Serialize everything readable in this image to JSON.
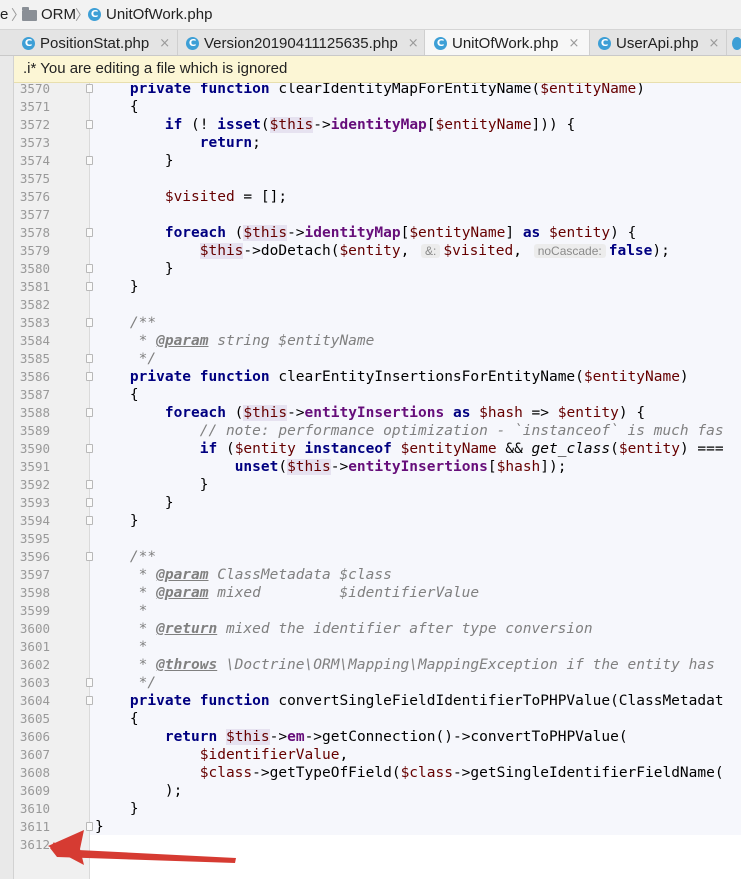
{
  "breadcrumb": {
    "first": "e",
    "folder": "ORM",
    "file": "UnitOfWork.php"
  },
  "tabs": [
    {
      "label": "PositionStat.php",
      "icon": "C",
      "active": false
    },
    {
      "label": "Version20190411125635.php",
      "icon": "C",
      "active": false
    },
    {
      "label": "UnitOfWork.php",
      "icon": "C",
      "active": true
    },
    {
      "label": "UserApi.php",
      "icon": "C",
      "active": false
    }
  ],
  "tab_close_glyph": "×",
  "notice": ".i* You are editing a file which is ignored",
  "line_numbers": [
    "3570",
    "3571",
    "3572",
    "3573",
    "3574",
    "3575",
    "3576",
    "3577",
    "3578",
    "3579",
    "3580",
    "3581",
    "3582",
    "3583",
    "3584",
    "3585",
    "3586",
    "3587",
    "3588",
    "3589",
    "3590",
    "3591",
    "3592",
    "3593",
    "3594",
    "3595",
    "3596",
    "3597",
    "3598",
    "3599",
    "3600",
    "3601",
    "3602",
    "3603",
    "3604",
    "3605",
    "3606",
    "3607",
    "3608",
    "3609",
    "3610",
    "3611",
    "3612"
  ],
  "code_lines": [
    "    private function clearIdentityMapForEntityName($entityName)",
    "    {",
    "        if (! isset($this->identityMap[$entityName])) {",
    "            return;",
    "        }",
    "",
    "        $visited = [];",
    "",
    "        foreach ($this->identityMap[$entityName] as $entity) {",
    "            $this->doDetach($entity, &: $visited, noCascade: false);",
    "        }",
    "    }",
    "",
    "    /**",
    "     * @param string $entityName",
    "     */",
    "    private function clearEntityInsertionsForEntityName($entityName)",
    "    {",
    "        foreach ($this->entityInsertions as $hash => $entity) {",
    "            // note: performance optimization - `instanceof` is much fas",
    "            if ($entity instanceof $entityName && get_class($entity) ===",
    "                unset($this->entityInsertions[$hash]);",
    "            }",
    "        }",
    "    }",
    "",
    "    /**",
    "     * @param ClassMetadata $class",
    "     * @param mixed         $identifierValue",
    "     *",
    "     * @return mixed the identifier after type conversion",
    "     *",
    "     * @throws \\Doctrine\\ORM\\Mapping\\MappingException if the entity has",
    "     */",
    "    private function convertSingleFieldIdentifierToPHPValue(ClassMetadat",
    "    {",
    "        return $this->em->getConnection()->convertToPHPValue(",
    "            $identifierValue,",
    "            $class->getTypeOfField($class->getSingleIdentifierFieldName(",
    "        );",
    "    }",
    "}",
    ""
  ],
  "colors": {
    "keyword": "#000080",
    "variable": "#660000",
    "property": "#660e7a",
    "comment": "#808080",
    "arrow": "#d63b32"
  }
}
